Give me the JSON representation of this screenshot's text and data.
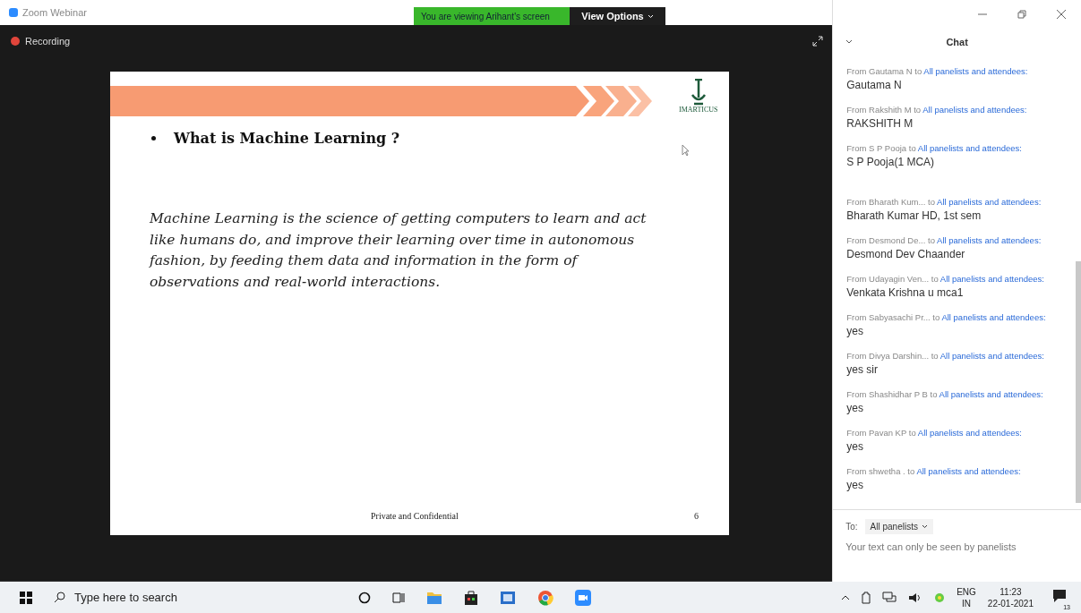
{
  "window": {
    "title": "Zoom Webinar"
  },
  "share_banner": {
    "text": "You are viewing Arihant's screen",
    "view_options": "View Options"
  },
  "recording": {
    "label": "Recording"
  },
  "slide": {
    "logo_text": "IMARTICUS",
    "heading": "What is Machine Learning ?",
    "body": "Machine Learning is the science of getting computers to learn and act like humans do, and improve their learning over time in autonomous fashion, by feeding them data and information in the form of observations and real-world interactions.",
    "footer": "Private and Confidential",
    "page": "6"
  },
  "chat": {
    "title": "Chat",
    "messages": [
      {
        "from": "From Gautama N to",
        "to": "All panelists and attendees:",
        "text": "Gautama N"
      },
      {
        "from": "From Rakshith M to",
        "to": "All panelists and attendees:",
        "text": "RAKSHITH M"
      },
      {
        "from": "From S P Pooja to",
        "to": "All panelists and attendees:",
        "text": "S P Pooja(1 MCA)",
        "kind": "multiline"
      },
      {
        "from": "From Bharath Kum...  to",
        "to": "All panelists and attendees:",
        "text": "Bharath Kumar HD, 1st sem"
      },
      {
        "from": "From Desmond De...  to",
        "to": "All panelists and attendees:",
        "text": "Desmond Dev Chaander"
      },
      {
        "from": "From Udayagin Ven... to",
        "to": "All panelists and attendees:",
        "text": "Venkata Krishna u mca1"
      },
      {
        "from": "From Sabyasachi Pr... to",
        "to": "All panelists and attendees:",
        "text": "yes"
      },
      {
        "from": "From Divya Darshin... to",
        "to": "All panelists and attendees:",
        "text": "yes sir"
      },
      {
        "from": "From Shashidhar P B to",
        "to": "All panelists and attendees:",
        "text": "yes"
      },
      {
        "from": "From Pavan KP to",
        "to": "All panelists and attendees:",
        "text": "yes"
      },
      {
        "from": "From shwetha . to",
        "to": "All panelists and attendees:",
        "text": "yes"
      }
    ],
    "to_label": "To:",
    "recipient": "All panelists",
    "placeholder": "Your text can only be seen by panelists"
  },
  "taskbar": {
    "search_placeholder": "Type here to search",
    "language": "ENG",
    "region": "IN",
    "time": "11:23",
    "date": "22-01-2021",
    "notifications": "13"
  }
}
